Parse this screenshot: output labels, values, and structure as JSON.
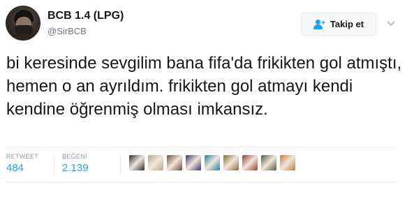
{
  "user": {
    "name": "BCB 1.4 (LPG)",
    "handle": "@SirBCB"
  },
  "follow_button": {
    "label": "Takip et",
    "icon": "follow-user-icon"
  },
  "tweet": {
    "text": "bi keresinde sevgilim bana fifa'da frikikten gol atmıştı, hemen o an ayrıldım. frikikten gol atmayı kendi kendine öğrenmiş olması imkansız."
  },
  "stats": {
    "retweets_label": "RETWEET",
    "retweets_value": "484",
    "likes_label": "BEĞENİ",
    "likes_value": "2.139"
  },
  "likers": {
    "colors": [
      "#2a2a2a",
      "#b8a48e",
      "#6b4a3a",
      "#3b2f6b",
      "#1f7fa8",
      "#8a6a3a",
      "#9a3b2a",
      "#4a5a3a",
      "#c07a3a"
    ]
  }
}
